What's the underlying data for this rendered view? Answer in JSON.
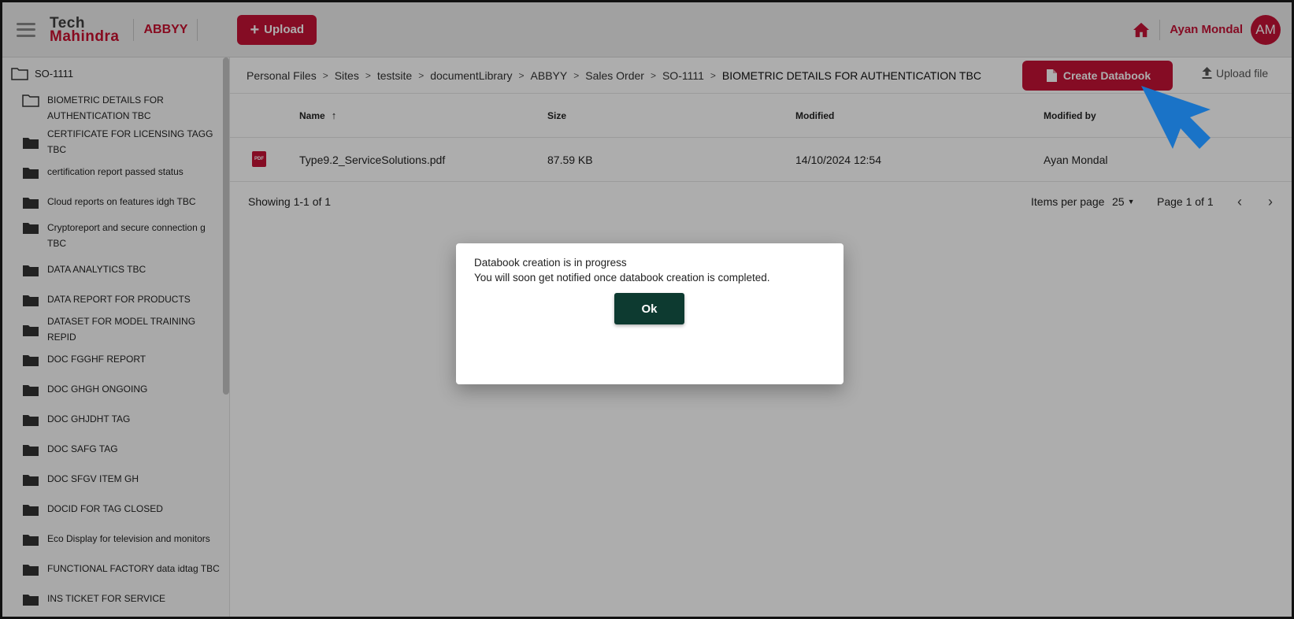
{
  "header": {
    "logo_line1": "Tech",
    "logo_line2": "Mahindra",
    "brand": "ABBYY",
    "upload_label": "Upload",
    "user_name": "Ayan Mondal",
    "avatar_initials": "AM"
  },
  "sidebar": {
    "root": "SO-1111",
    "items": [
      {
        "label": "BIOMETRIC DETAILS FOR AUTHENTICATION TBC",
        "icon": "folder-open-icon"
      },
      {
        "label": "CERTIFICATE FOR LICENSING TAGG TBC",
        "icon": "folder-icon"
      },
      {
        "label": "certification report passed status",
        "icon": "folder-icon"
      },
      {
        "label": "Cloud reports on features idgh TBC",
        "icon": "folder-icon"
      },
      {
        "label": "Cryptoreport and secure connection g TBC",
        "icon": "folder-icon"
      },
      {
        "label": "DATA ANALYTICS TBC",
        "icon": "folder-icon"
      },
      {
        "label": "DATA REPORT FOR PRODUCTS",
        "icon": "folder-icon"
      },
      {
        "label": "DATASET FOR MODEL TRAINING REPID",
        "icon": "folder-icon"
      },
      {
        "label": "DOC FGGHF REPORT",
        "icon": "folder-icon"
      },
      {
        "label": "DOC GHGH ONGOING",
        "icon": "folder-icon"
      },
      {
        "label": "DOC GHJDHT TAG",
        "icon": "folder-icon"
      },
      {
        "label": "DOC SAFG TAG",
        "icon": "folder-icon"
      },
      {
        "label": "DOC SFGV ITEM GH",
        "icon": "folder-icon"
      },
      {
        "label": "DOCID FOR TAG CLOSED",
        "icon": "folder-icon"
      },
      {
        "label": "Eco Display for television and monitors",
        "icon": "folder-icon"
      },
      {
        "label": "FUNCTIONAL FACTORY data idtag TBC",
        "icon": "folder-icon"
      },
      {
        "label": "INS TICKET FOR SERVICE",
        "icon": "folder-icon"
      }
    ]
  },
  "breadcrumb": [
    "Personal Files",
    "Sites",
    "testsite",
    "documentLibrary",
    "ABBYY",
    "Sales Order",
    "SO-1111"
  ],
  "breadcrumb_current": "BIOMETRIC DETAILS FOR AUTHENTICATION TBC",
  "toolbar": {
    "create_databook": "Create Databook",
    "upload_file": "Upload file"
  },
  "table": {
    "headers": {
      "name": "Name",
      "size": "Size",
      "modified": "Modified",
      "modified_by": "Modified by"
    },
    "rows": [
      {
        "icon_text": "PDF",
        "name": "Type9.2_ServiceSolutions.pdf",
        "size": "87.59 KB",
        "modified": "14/10/2024 12:54",
        "modified_by": "Ayan Mondal"
      }
    ]
  },
  "pagination": {
    "showing": "Showing 1-1 of 1",
    "items_per_page_label": "Items per page",
    "items_per_page": "25",
    "page_label": "Page 1 of 1"
  },
  "dialog": {
    "line1": "Databook creation is in progress",
    "line2": "You will soon get notified once databook creation is completed.",
    "ok_label": "Ok"
  },
  "colors": {
    "accent": "#c41235",
    "ok_button": "#0d3a30",
    "cursor": "#1a73c7"
  }
}
